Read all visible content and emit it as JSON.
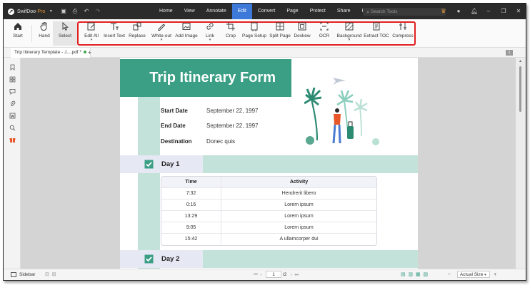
{
  "titlebar": {
    "app_name": "SwifDoo",
    "app_edition": "-Pro",
    "menu": [
      "Home",
      "View",
      "Annotate",
      "Edit",
      "Convert",
      "Page",
      "Protect",
      "Share",
      "Help"
    ],
    "active_menu": "Edit",
    "search_placeholder": "Search Tools"
  },
  "ribbon": {
    "start": "Start",
    "hand": "Hand",
    "select": "Select",
    "edit_all": "Edit All",
    "insert_text": "Insert Text",
    "replace": "Replace",
    "white_out": "White-out",
    "add_image": "Add Image",
    "link": "Link",
    "crop": "Crop",
    "page_setup": "Page Setup",
    "split_page": "Split Page",
    "deskew": "Deskew",
    "ocr": "OCR",
    "background": "Background",
    "extract_toc": "Extract TOC",
    "compress": "Compress"
  },
  "tabs": {
    "doc_tab": "Trip Itinerary Template - J....pdf *",
    "add_tab": "+",
    "page_badge": "1"
  },
  "document": {
    "title": "Trip Itinerary Form",
    "fields": [
      {
        "label": "Start Date",
        "value": "September 22, 1997"
      },
      {
        "label": "End Date",
        "value": "September 22, 1997"
      },
      {
        "label": "Destination",
        "value": "Donec quis"
      }
    ],
    "day1": "Day 1",
    "day2": "Day 2",
    "table_headers": {
      "time": "Time",
      "activity": "Activity"
    },
    "rows": [
      {
        "time": "7:32",
        "activity": "Hendrerit libero"
      },
      {
        "time": "0:16",
        "activity": "Lorem ipsum"
      },
      {
        "time": "13:29",
        "activity": "Lorem ipsum"
      },
      {
        "time": "9:05",
        "activity": "Lorem ipsum"
      },
      {
        "time": "15:42",
        "activity": "A ullamcorper dui"
      }
    ]
  },
  "statusbar": {
    "sidebar": "Sidebar",
    "current_page": "1",
    "total_pages": "/2",
    "zoom": "Actual Size"
  },
  "colors": {
    "accent": "#3b9f85",
    "light_green": "#c3e2d9",
    "highlight_box": "#e21f1f",
    "active_menu": "#3d79d9"
  }
}
